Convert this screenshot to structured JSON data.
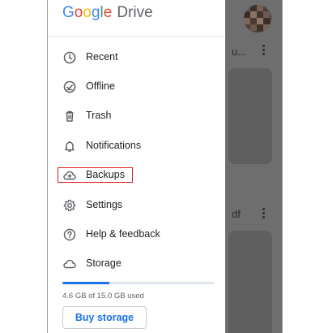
{
  "app": {
    "logo_part1": [
      "G",
      "o",
      "o",
      "g",
      "l",
      "e"
    ],
    "logo_colors": [
      "#4285F4",
      "#EA4335",
      "#FBBC05",
      "#4285F4",
      "#34A853",
      "#EA4335"
    ],
    "logo_part2": "Drive"
  },
  "background": {
    "file1_title": "u...",
    "file2_title": "df"
  },
  "menu": {
    "items": [
      {
        "label": "Recent",
        "icon": "clock-icon"
      },
      {
        "label": "Offline",
        "icon": "offline-check-icon"
      },
      {
        "label": "Trash",
        "icon": "trash-icon"
      },
      {
        "label": "Notifications",
        "icon": "bell-icon"
      },
      {
        "label": "Backups",
        "icon": "cloud-upload-icon"
      },
      {
        "label": "Settings",
        "icon": "gear-icon"
      },
      {
        "label": "Help & feedback",
        "icon": "help-icon"
      },
      {
        "label": "Storage",
        "icon": "cloud-icon"
      }
    ]
  },
  "storage": {
    "used_text": "4.6 GB of 15.0 GB used",
    "used_fraction": 0.31,
    "buy_label": "Buy storage"
  },
  "colors": {
    "accent": "#1a73e8",
    "highlight_border": "#e02020"
  }
}
